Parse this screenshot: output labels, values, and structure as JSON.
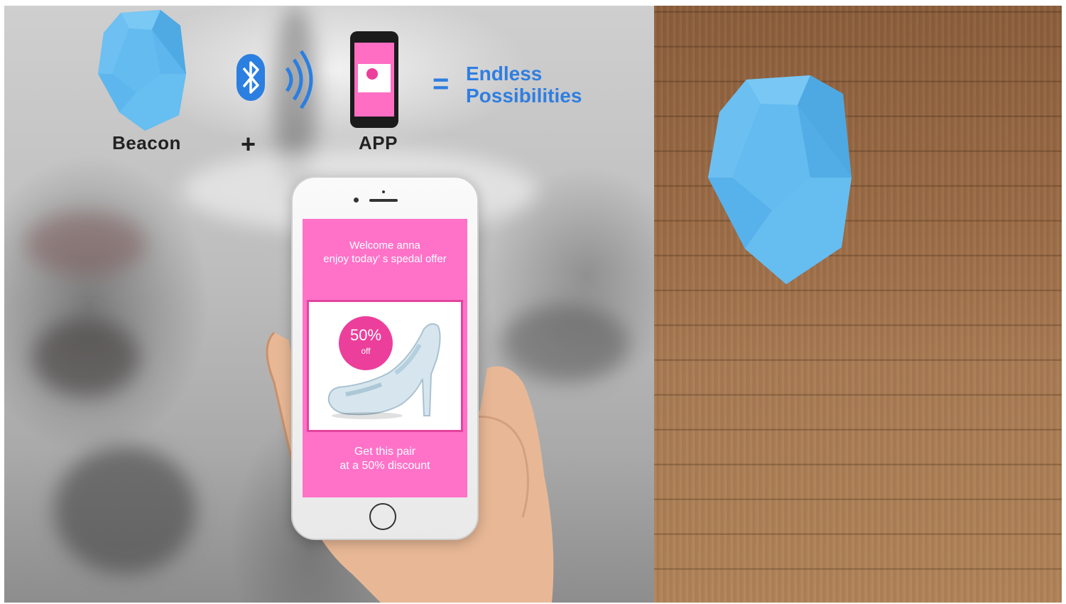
{
  "diagram": {
    "beacon_label": "Beacon",
    "plus_sign": "+",
    "app_label": "APP",
    "equals_sign": "=",
    "result_line1": "Endless",
    "result_line2": "Possibilities"
  },
  "phone_screen": {
    "welcome_line1": "Welcome anna",
    "welcome_line2": "enjoy today’ s spedal offer",
    "badge_percent": "50%",
    "badge_off": "off",
    "cta_line1": "Get this pair",
    "cta_line2": "at a 50% discount"
  },
  "colors": {
    "beacon_blue": "#5bb4ec",
    "accent_blue": "#2f7ee0",
    "screen_pink": "#ff72c8",
    "badge_pink": "#ec3f9c",
    "floor_brown": "#9a6b46"
  }
}
